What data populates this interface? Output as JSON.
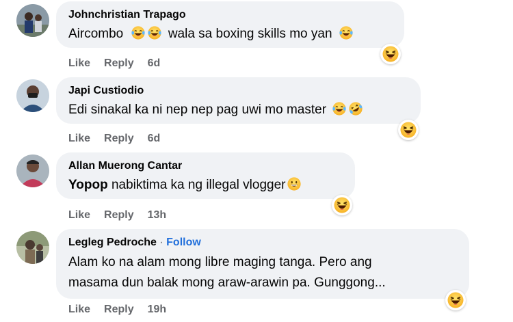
{
  "actions": {
    "like": "Like",
    "reply": "Reply"
  },
  "comments": [
    {
      "author": "Johnchristian Trapago",
      "text_parts": [
        "Aircombo",
        "wala sa boxing skills mo yan"
      ],
      "time": "6d",
      "reaction_icon": "haha-reaction-icon"
    },
    {
      "author": "Japi Custiodio",
      "text": "Edi sinakal ka ni nep nep pag uwi mo master",
      "time": "6d",
      "reaction_icon": "haha-reaction-icon"
    },
    {
      "author": "Allan Muerong Cantar",
      "text_bold": "Yopop",
      "text": " nabiktima ka ng illegal vlogger",
      "time": "13h",
      "reaction_icon": "haha-reaction-icon"
    },
    {
      "author": "Legleg Pedroche",
      "follow_sep": " · ",
      "follow": "Follow",
      "text_lines": [
        "Alam ko na alam mong libre maging tanga. Pero ang",
        "masama dun balak mong araw-arawin pa. Gunggong..."
      ],
      "time": "19h",
      "reaction_icon": "haha-reaction-icon"
    }
  ],
  "colors": {
    "bubble": "#f0f2f5",
    "follow": "#216fdb",
    "meta": "#65676b",
    "haha": "#f7b125"
  }
}
